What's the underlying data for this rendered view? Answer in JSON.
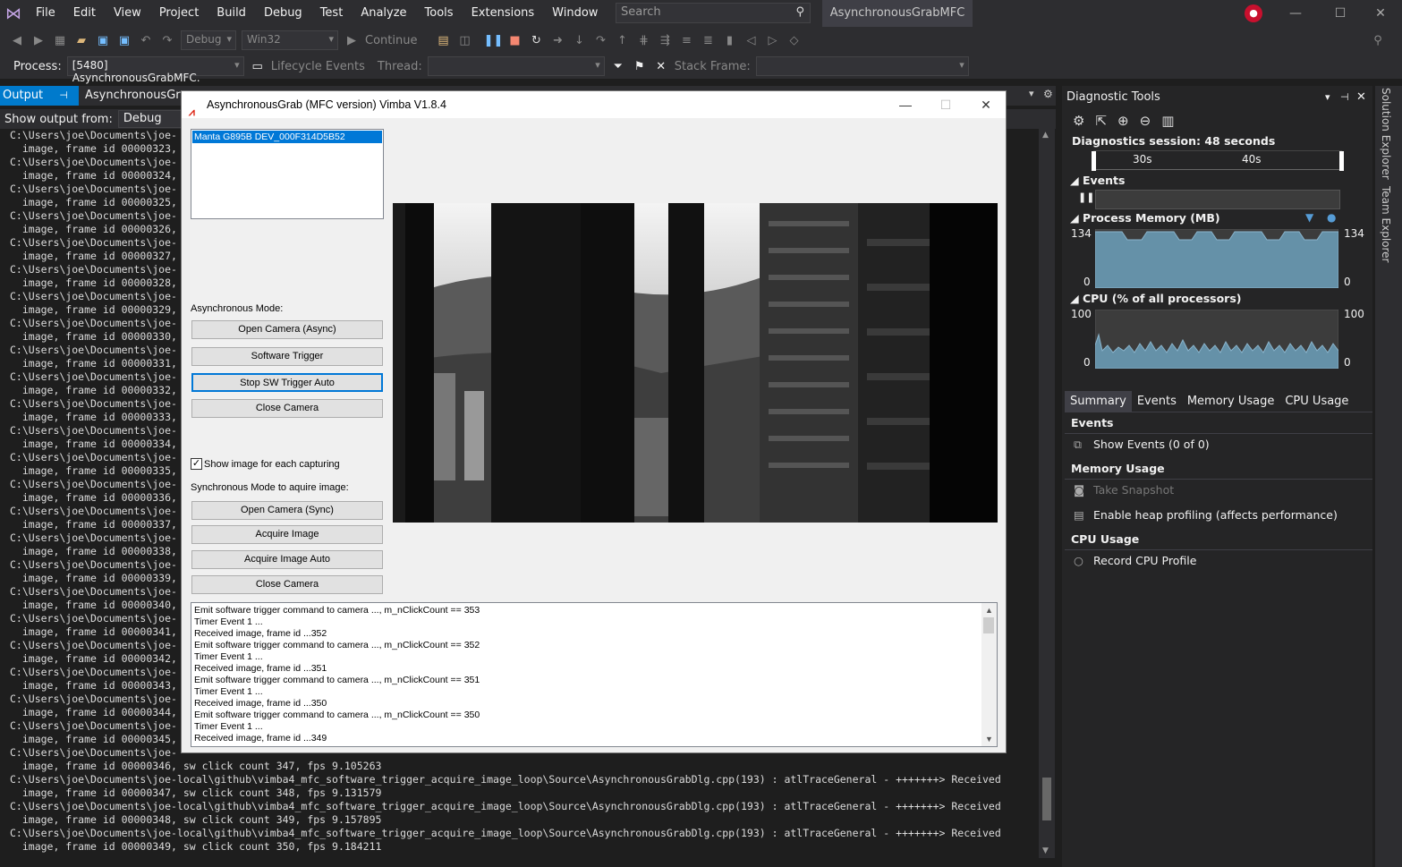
{
  "menubar": {
    "items": [
      "File",
      "Edit",
      "View",
      "Project",
      "Build",
      "Debug",
      "Test",
      "Analyze",
      "Tools",
      "Extensions",
      "Window",
      "Help"
    ],
    "search_placeholder": "Search",
    "app_title": "AsynchronousGrabMFC"
  },
  "toolbar": {
    "config": "Debug",
    "platform": "Win32",
    "continue_label": "Continue",
    "process_label": "Process:",
    "process_value": "[5480] AsynchronousGrabMFC.",
    "lifecycle_label": "Lifecycle Events",
    "thread_label": "Thread:",
    "stackframe_label": "Stack Frame:"
  },
  "output": {
    "tab_label": "Output",
    "tab2_label": "AsynchronousGrab",
    "show_from_label": "Show output from:",
    "show_from_value": "Debug",
    "lines": [
      "C:\\Users\\joe\\Documents\\joe-",
      "  image, frame id 00000323,",
      "C:\\Users\\joe\\Documents\\joe-",
      "  image, frame id 00000324,",
      "C:\\Users\\joe\\Documents\\joe-",
      "  image, frame id 00000325,",
      "C:\\Users\\joe\\Documents\\joe-",
      "  image, frame id 00000326,",
      "C:\\Users\\joe\\Documents\\joe-",
      "  image, frame id 00000327,",
      "C:\\Users\\joe\\Documents\\joe-",
      "  image, frame id 00000328,",
      "C:\\Users\\joe\\Documents\\joe-",
      "  image, frame id 00000329,",
      "C:\\Users\\joe\\Documents\\joe-",
      "  image, frame id 00000330,",
      "C:\\Users\\joe\\Documents\\joe-",
      "  image, frame id 00000331,",
      "C:\\Users\\joe\\Documents\\joe-",
      "  image, frame id 00000332,",
      "C:\\Users\\joe\\Documents\\joe-",
      "  image, frame id 00000333,",
      "C:\\Users\\joe\\Documents\\joe-",
      "  image, frame id 00000334,",
      "C:\\Users\\joe\\Documents\\joe-",
      "  image, frame id 00000335,",
      "C:\\Users\\joe\\Documents\\joe-",
      "  image, frame id 00000336,",
      "C:\\Users\\joe\\Documents\\joe-",
      "  image, frame id 00000337,",
      "C:\\Users\\joe\\Documents\\joe-",
      "  image, frame id 00000338,",
      "C:\\Users\\joe\\Documents\\joe-",
      "  image, frame id 00000339,",
      "C:\\Users\\joe\\Documents\\joe-",
      "  image, frame id 00000340,",
      "C:\\Users\\joe\\Documents\\joe-",
      "  image, frame id 00000341,",
      "C:\\Users\\joe\\Documents\\joe-",
      "  image, frame id 00000342,",
      "C:\\Users\\joe\\Documents\\joe-",
      "  image, frame id 00000343,",
      "C:\\Users\\joe\\Documents\\joe-",
      "  image, frame id 00000344,",
      "C:\\Users\\joe\\Documents\\joe-",
      "  image, frame id 00000345,",
      "C:\\Users\\joe\\Documents\\joe-",
      "  image, frame id 00000346, sw click count 347, fps 9.105263",
      "C:\\Users\\joe\\Documents\\joe-local\\github\\vimba4_mfc_software_trigger_acquire_image_loop\\Source\\AsynchronousGrabDlg.cpp(193) : atlTraceGeneral - +++++++> Received",
      "  image, frame id 00000347, sw click count 348, fps 9.131579",
      "C:\\Users\\joe\\Documents\\joe-local\\github\\vimba4_mfc_software_trigger_acquire_image_loop\\Source\\AsynchronousGrabDlg.cpp(193) : atlTraceGeneral - +++++++> Received",
      "  image, frame id 00000348, sw click count 349, fps 9.157895",
      "C:\\Users\\joe\\Documents\\joe-local\\github\\vimba4_mfc_software_trigger_acquire_image_loop\\Source\\AsynchronousGrabDlg.cpp(193) : atlTraceGeneral - +++++++> Received",
      "  image, frame id 00000349, sw click count 350, fps 9.184211"
    ]
  },
  "diag": {
    "title": "Diagnostic Tools",
    "session": "Diagnostics session: 48 seconds",
    "tick_30": "30s",
    "tick_40": "40s",
    "events_title": "Events",
    "memory_title": "Process Memory (MB)",
    "memory_max": "134",
    "memory_min": "0",
    "cpu_title": "CPU (% of all processors)",
    "cpu_max": "100",
    "cpu_min": "0",
    "tabs": [
      "Summary",
      "Events",
      "Memory Usage",
      "CPU Usage"
    ],
    "sec_events": "Events",
    "show_events": "Show Events (0 of 0)",
    "sec_memory": "Memory Usage",
    "take_snapshot": "Take Snapshot",
    "heap_profiling": "Enable heap profiling (affects performance)",
    "sec_cpu": "CPU Usage",
    "record_cpu": "Record CPU Profile",
    "accent": "#569cd6"
  },
  "sidetabs": {
    "solution_explorer": "Solution Explorer",
    "team_explorer": "Team Explorer"
  },
  "dialog": {
    "title": "AsynchronousGrab (MFC version) Vimba V1.8.4",
    "camera": "Manta G895B DEV_000F314D5B52",
    "async_label": "Asynchronous Mode:",
    "open_async": "Open Camera (Async)",
    "sw_trigger": "Software Trigger",
    "stop_sw_trigger": "Stop SW Trigger Auto",
    "close_camera1": "Close Camera",
    "show_image_label": "Show image for each capturing",
    "sync_label": "Synchronous Mode to aquire image:",
    "open_sync": "Open Camera (Sync)",
    "acquire_image": "Acquire Image",
    "acquire_auto": "Acquire Image Auto",
    "close_camera2": "Close Camera",
    "log_lines": [
      "Emit software trigger command to camera ..., m_nClickCount == 353",
      "Timer Event 1 ...",
      "Received image, frame id ...352",
      "Emit software trigger command to camera ..., m_nClickCount == 352",
      "Timer Event 1 ...",
      "Received image, frame id ...351",
      "Emit software trigger command to camera ..., m_nClickCount == 351",
      "Timer Event 1 ...",
      "Received image, frame id ...350",
      "Emit software trigger command to camera ..., m_nClickCount == 350",
      "Timer Event 1 ...",
      "Received image, frame id ...349"
    ]
  }
}
